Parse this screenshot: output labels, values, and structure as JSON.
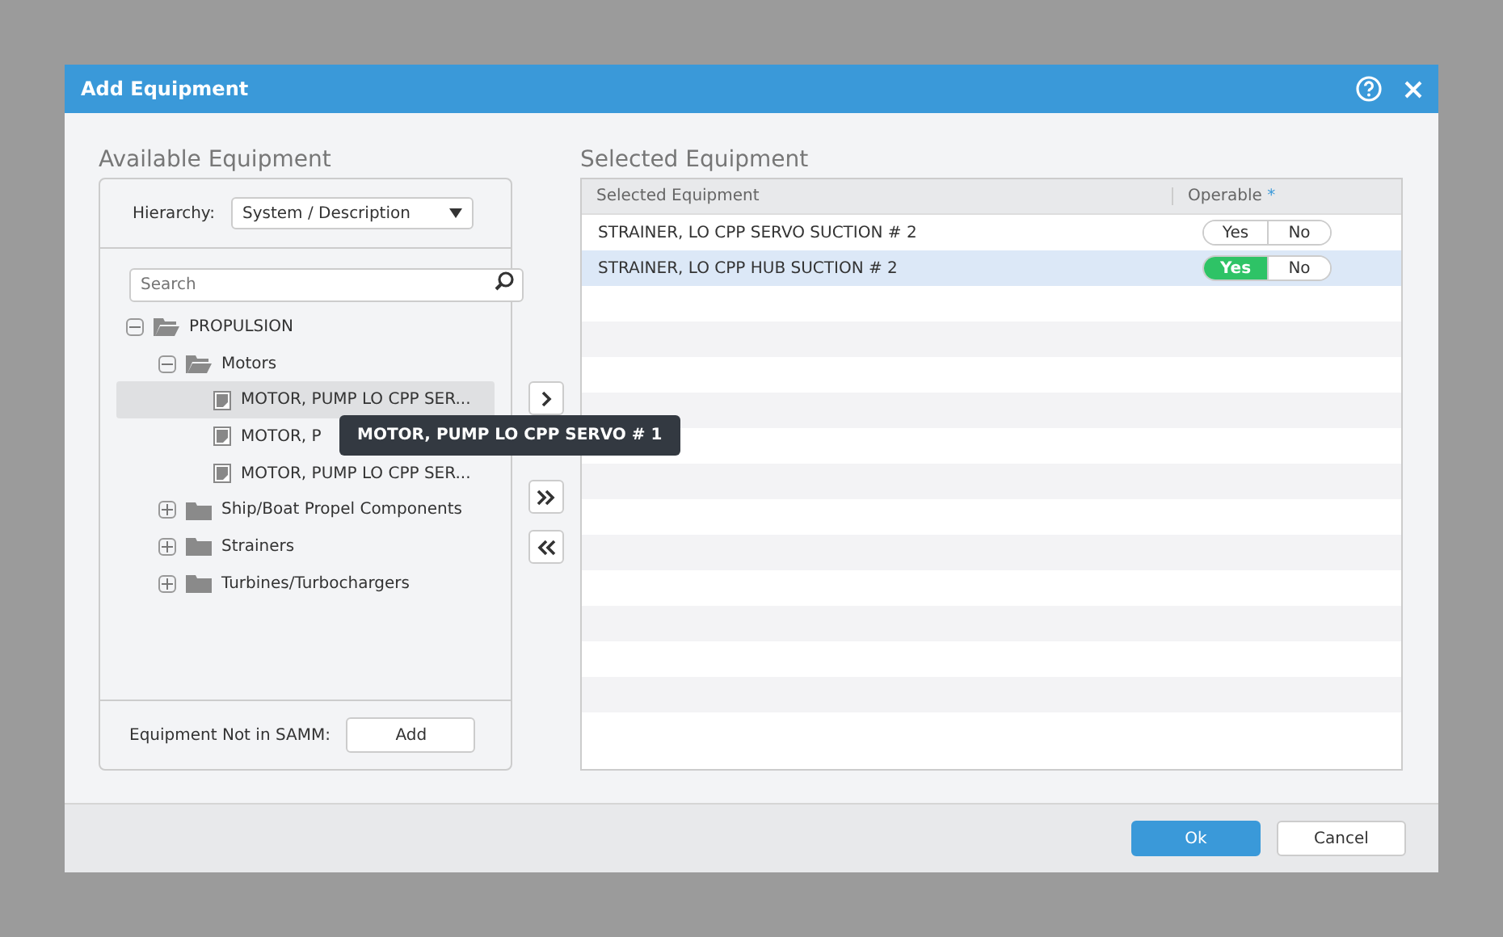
{
  "dialog": {
    "title": "Add Equipment"
  },
  "available": {
    "title": "Available Equipment",
    "hierarchy_label": "Hierarchy:",
    "hierarchy_value": "System / Description",
    "search_placeholder": "Search",
    "tree": [
      {
        "label": "PROPULSION",
        "kind": "folder",
        "expanded": true,
        "selected": false,
        "children": [
          {
            "label": "Motors",
            "kind": "folder",
            "expanded": true,
            "selected": false,
            "children": [
              {
                "label": "MOTOR, PUMP LO CPP SER...",
                "kind": "item",
                "selected": true,
                "tooltip": "MOTOR, PUMP LO CPP SERVO # 1"
              },
              {
                "label": "MOTOR, P",
                "kind": "item",
                "selected": false
              },
              {
                "label": "MOTOR, PUMP LO CPP SER...",
                "kind": "item",
                "selected": false
              }
            ]
          },
          {
            "label": "Ship/Boat Propel Components",
            "kind": "folder",
            "expanded": false,
            "selected": false
          },
          {
            "label": "Strainers",
            "kind": "folder",
            "expanded": false,
            "selected": false
          },
          {
            "label": "Turbines/Turbochargers",
            "kind": "folder",
            "expanded": false,
            "selected": false
          }
        ]
      }
    ],
    "not_in_label": "Equipment Not in SAMM:",
    "add_button": "Add"
  },
  "selected": {
    "title": "Selected Equipment",
    "columns": [
      "Selected Equipment",
      "Operable"
    ],
    "required_mark": "*",
    "rows": [
      {
        "name": "STRAINER, LO CPP SERVO SUCTION # 2",
        "selected": false,
        "options": [
          {
            "label": "Yes",
            "selected": false
          },
          {
            "label": "No",
            "selected": false
          }
        ]
      },
      {
        "name": "STRAINER, LO CPP HUB SUCTION # 2",
        "selected": true,
        "options": [
          {
            "label": "Yes",
            "selected": true
          },
          {
            "label": "No",
            "selected": false
          }
        ]
      }
    ]
  },
  "buttons": [
    "Ok",
    "Cancel"
  ]
}
